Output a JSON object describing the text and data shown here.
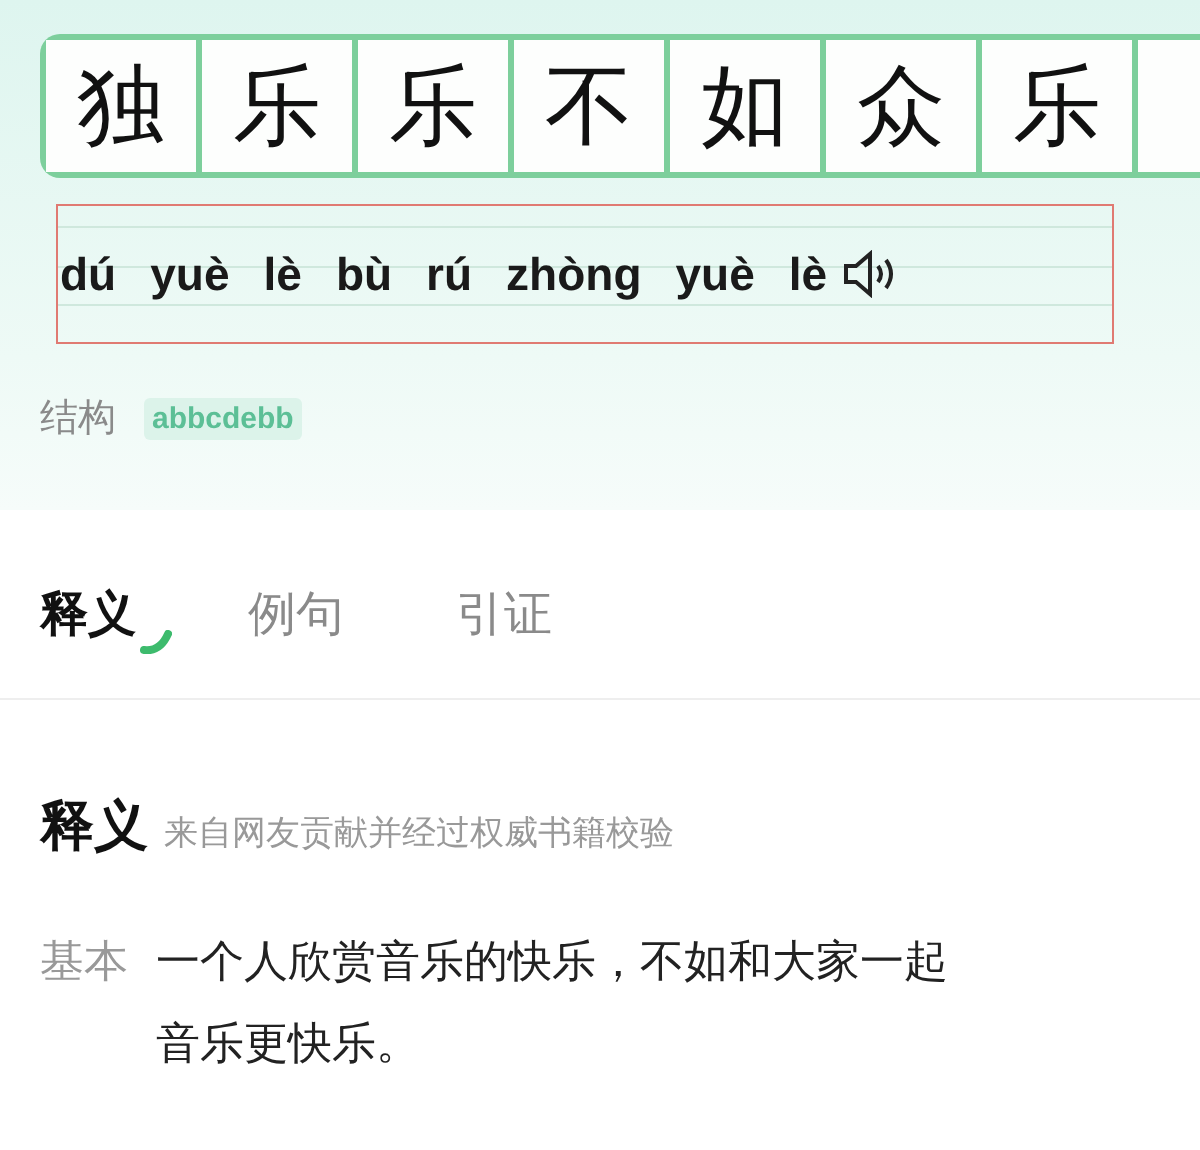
{
  "idiom": {
    "characters": [
      "独",
      "乐",
      "乐",
      "不",
      "如",
      "众",
      "乐"
    ],
    "pinyin": [
      "dú",
      "yuè",
      "lè",
      "bù",
      "rú",
      "zhòng",
      "yuè",
      "lè"
    ],
    "structure_label": "结构",
    "structure": "abbcdebb"
  },
  "tabs": [
    {
      "label": "释义",
      "selected": true
    },
    {
      "label": "例句",
      "selected": false
    },
    {
      "label": "引证",
      "selected": false
    }
  ],
  "definition": {
    "title": "释义",
    "source": "来自网友贡献并经过权威书籍校验",
    "entries": [
      {
        "label": "基本",
        "lines": [
          "一个人欣赏音乐的快乐，不如和大家一起",
          "音乐更快乐。"
        ]
      }
    ]
  }
}
